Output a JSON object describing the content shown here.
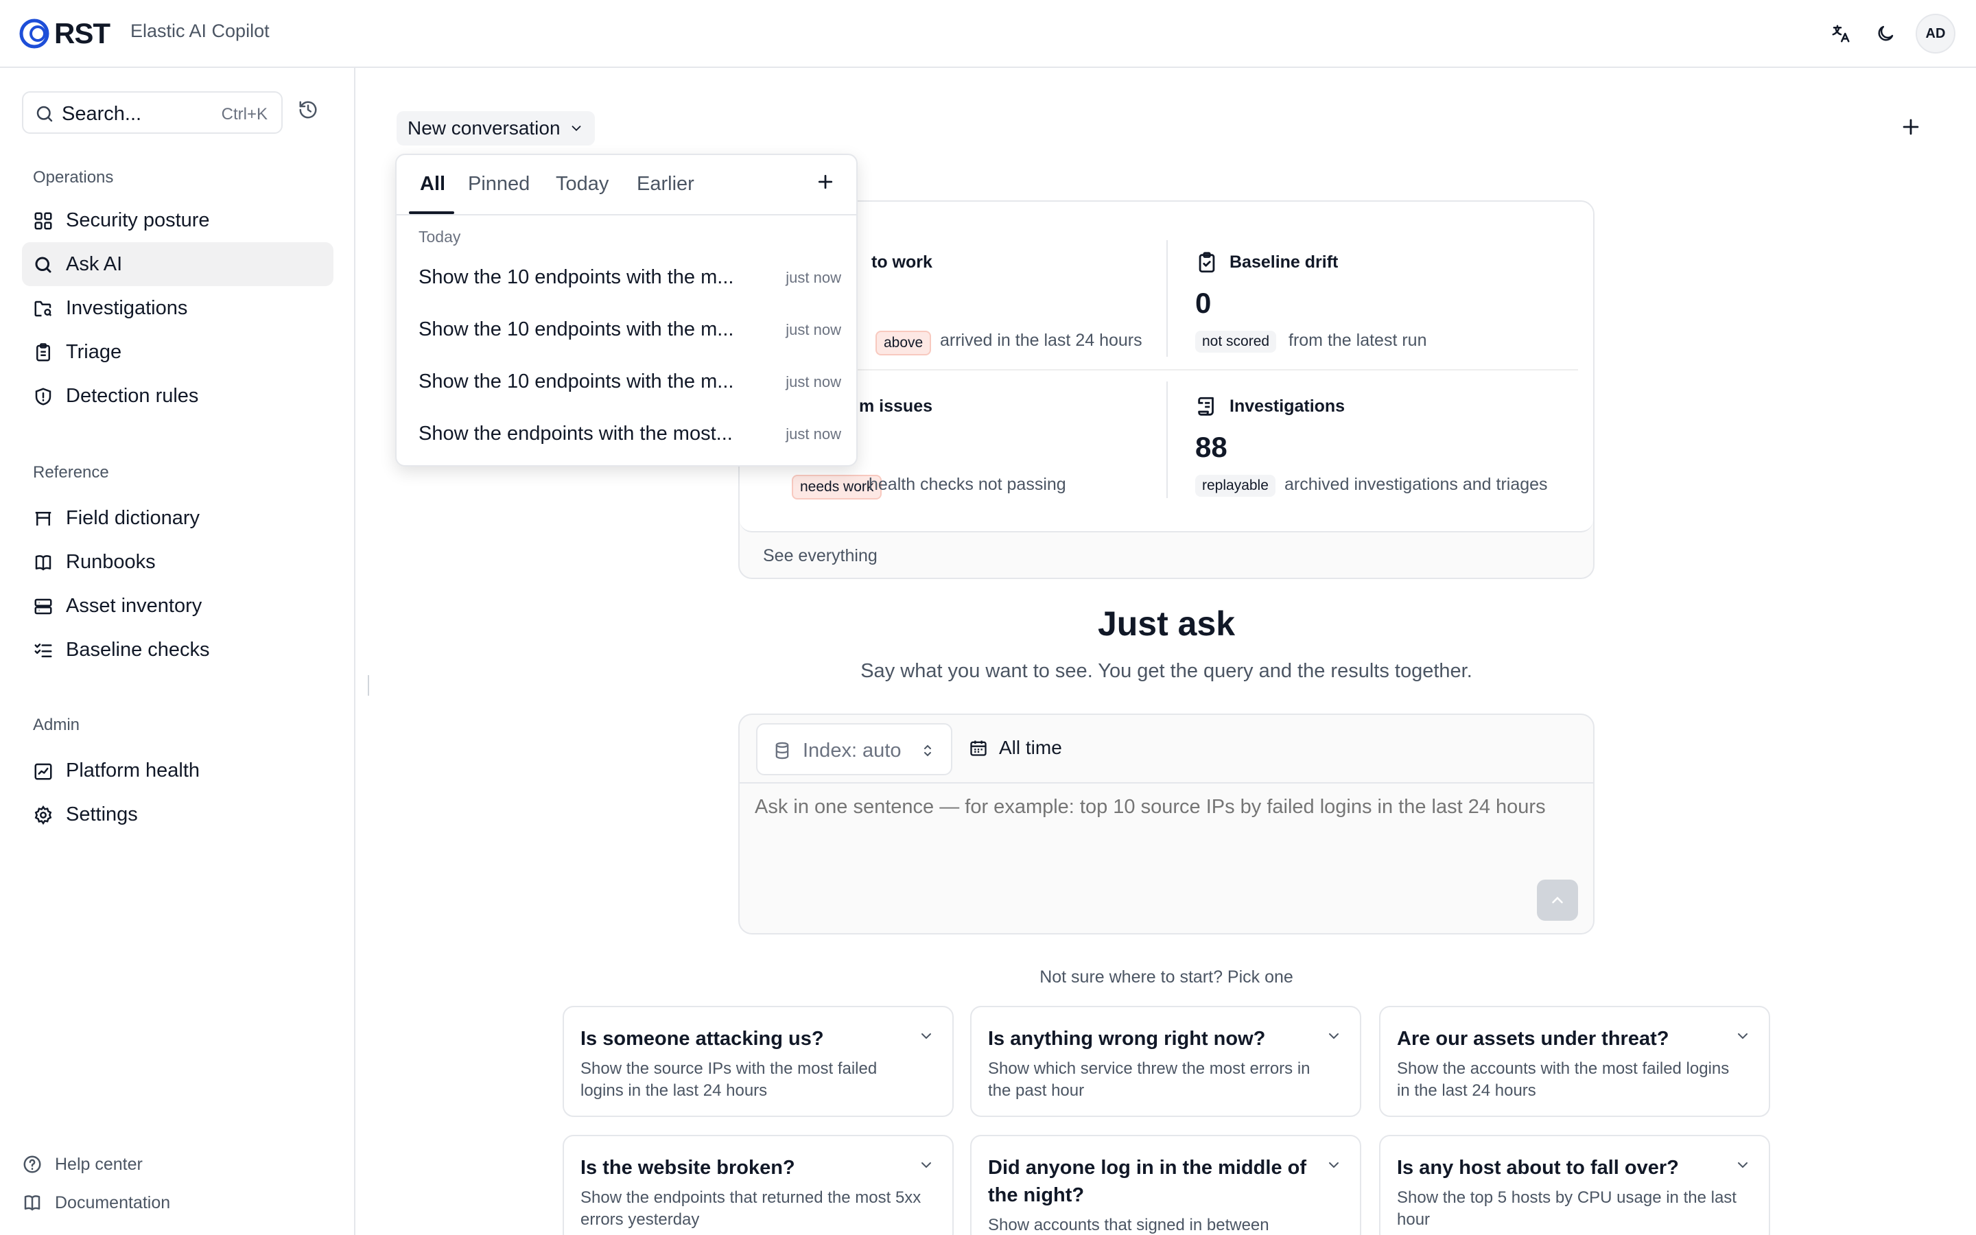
{
  "header": {
    "brand": "RST",
    "app_title": "Elastic AI Copilot",
    "avatar_initials": "AD",
    "icons": [
      "translate-icon",
      "moon-icon"
    ]
  },
  "sidebar": {
    "search_placeholder": "Search...",
    "search_shortcut": "Ctrl+K",
    "sections": {
      "operations": "Operations",
      "reference": "Reference",
      "admin": "Admin"
    },
    "operations_items": [
      {
        "label": "Security posture",
        "icon": "grid-icon"
      },
      {
        "label": "Ask AI",
        "icon": "search-icon",
        "active": true
      },
      {
        "label": "Investigations",
        "icon": "folder-search-icon"
      },
      {
        "label": "Triage",
        "icon": "clipboard-icon"
      },
      {
        "label": "Detection rules",
        "icon": "shield-alert-icon"
      }
    ],
    "reference_items": [
      {
        "label": "Field dictionary",
        "icon": "table-icon"
      },
      {
        "label": "Runbooks",
        "icon": "book-icon"
      },
      {
        "label": "Asset inventory",
        "icon": "server-icon"
      },
      {
        "label": "Baseline checks",
        "icon": "list-checks-icon"
      }
    ],
    "admin_items": [
      {
        "label": "Platform health",
        "icon": "activity-icon"
      },
      {
        "label": "Settings",
        "icon": "gear-icon"
      }
    ],
    "footer": {
      "help": "Help center",
      "docs": "Documentation"
    }
  },
  "main": {
    "conversation_label": "New conversation",
    "overview": {
      "cells": [
        {
          "title": "to work",
          "value": "",
          "badge": "above",
          "desc": "arrived in the last 24 hours"
        },
        {
          "title": "Baseline drift",
          "value": "0",
          "badge": "not scored",
          "desc": "from the latest run"
        },
        {
          "title": "m issues",
          "value": "",
          "badge": "needs work",
          "desc": "health checks not passing"
        },
        {
          "title": "Investigations",
          "value": "88",
          "badge": "replayable",
          "desc": "archived investigations and triages"
        }
      ],
      "see_all": "See everything"
    },
    "history_popover": {
      "tabs": [
        "All",
        "Pinned",
        "Today",
        "Earlier"
      ],
      "active_tab": "All",
      "group_label": "Today",
      "items": [
        {
          "text": "Show the 10 endpoints with the m...",
          "time": "just now"
        },
        {
          "text": "Show the 10 endpoints with the m...",
          "time": "just now"
        },
        {
          "text": "Show the 10 endpoints with the m...",
          "time": "just now"
        },
        {
          "text": "Show the endpoints with the most...",
          "time": "just now"
        }
      ]
    },
    "just_ask": {
      "title": "Just ask",
      "subtitle": "Say what you want to see. You get the query and the results together."
    },
    "composer": {
      "index_label": "Index: auto",
      "time_label": "All time",
      "placeholder": "Ask in one sentence — for example: top 10 source IPs by failed logins in the last 24 hours"
    },
    "suggestions_label": "Not sure where to start? Pick one",
    "suggestions": [
      {
        "title": "Is someone attacking us?",
        "desc": "Show the source IPs with the most failed logins in the last 24 hours"
      },
      {
        "title": "Is anything wrong right now?",
        "desc": "Show which service threw the most errors in the past hour"
      },
      {
        "title": "Are our assets under threat?",
        "desc": "Show the accounts with the most failed logins in the last 24 hours"
      },
      {
        "title": "Is the website broken?",
        "desc": "Show the endpoints that returned the most 5xx errors yesterday"
      },
      {
        "title": "Did anyone log in in the middle of the night?",
        "desc": "Show accounts that signed in between"
      },
      {
        "title": "Is any host about to fall over?",
        "desc": "Show the top 5 hosts by CPU usage in the last hour"
      }
    ]
  },
  "colors": {
    "brand_blue": "#1d4ed8",
    "active_bg": "#f1f1f2",
    "warn_badge_bg": "#fde8e4"
  }
}
